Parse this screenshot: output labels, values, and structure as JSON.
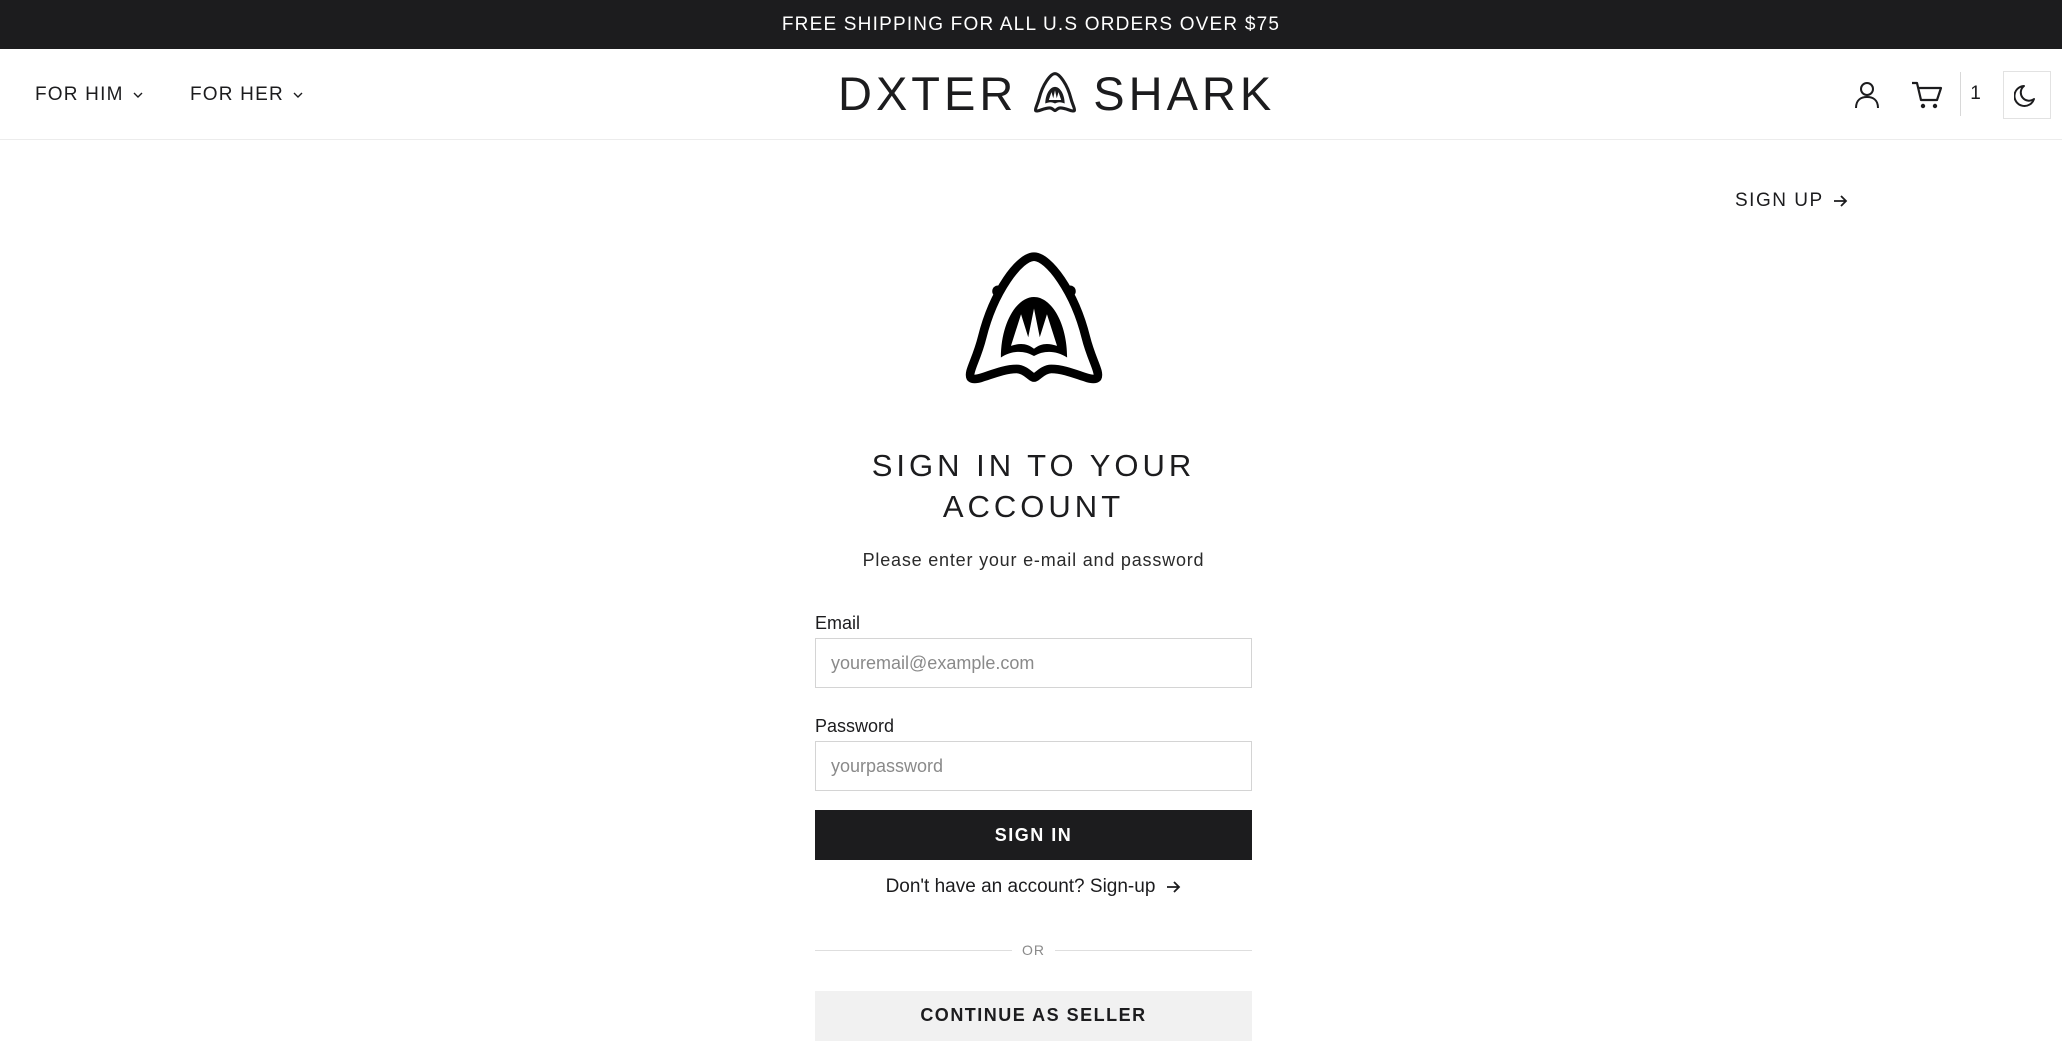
{
  "announcement": "FREE SHIPPING FOR ALL U.S ORDERS OVER $75",
  "nav": {
    "items": [
      {
        "label": "FOR HIM",
        "icon": "chevron-down-icon"
      },
      {
        "label": "FOR HER",
        "icon": "chevron-down-icon"
      }
    ]
  },
  "brand": {
    "left": "DXTER",
    "right": "SHARK",
    "icon": "shark-logo-icon"
  },
  "header_icons": {
    "account": "user-icon",
    "cart": "cart-icon",
    "cart_count": "1",
    "theme": "moon-icon"
  },
  "signup_link": {
    "label": "SIGN UP",
    "icon": "arrow-right-icon"
  },
  "form": {
    "title": "SIGN IN TO YOUR ACCOUNT",
    "subtitle": "Please enter your e-mail and password",
    "email_label": "Email",
    "email_placeholder": "youremail@example.com",
    "password_label": "Password",
    "password_placeholder": "yourpassword",
    "submit_label": "SIGN IN",
    "alt_link": "Don't have an account? Sign-up",
    "divider": "OR",
    "seller_label": "CONTINUE AS SELLER"
  },
  "colors": {
    "dark": "#1c1c1e",
    "light_button": "#f1f1f1",
    "border": "#d4d4d4"
  }
}
